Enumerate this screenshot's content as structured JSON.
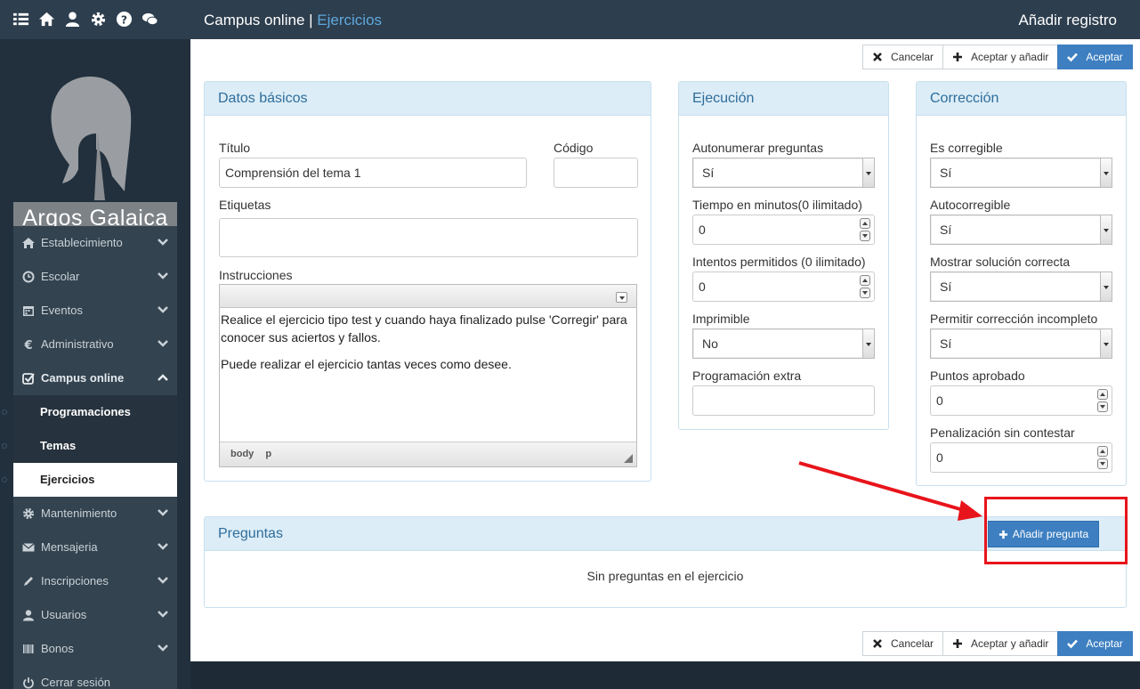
{
  "topbar": {
    "app": "Campus online",
    "separator": "|",
    "section": "Ejercicios",
    "action": "Añadir registro",
    "icons": [
      "list-icon",
      "home-icon",
      "user-icon",
      "gear-icon",
      "help-icon",
      "chat-icon"
    ]
  },
  "brand": {
    "name": "Argos Galaica"
  },
  "sidebar": {
    "items": [
      {
        "label": "Establecimiento",
        "icon": "home-icon"
      },
      {
        "label": "Escolar",
        "icon": "clock-icon"
      },
      {
        "label": "Eventos",
        "icon": "calendar-icon"
      },
      {
        "label": "Administrativo",
        "icon": "euro-icon"
      },
      {
        "label": "Campus online",
        "icon": "checkbox-icon"
      },
      {
        "label": "Mantenimiento",
        "icon": "gear-icon"
      },
      {
        "label": "Mensajeria",
        "icon": "envelope-icon"
      },
      {
        "label": "Inscripciones",
        "icon": "pencil-icon"
      },
      {
        "label": "Usuarios",
        "icon": "user-icon"
      },
      {
        "label": "Bonos",
        "icon": "barcode-icon"
      },
      {
        "label": "Cerrar sesión",
        "icon": "power-icon"
      }
    ],
    "subitems": [
      {
        "label": "Programaciones"
      },
      {
        "label": "Temas"
      },
      {
        "label": "Ejercicios"
      }
    ]
  },
  "actions": {
    "cancel": "Cancelar",
    "accept_add": "Aceptar y añadir",
    "accept": "Aceptar"
  },
  "basic": {
    "title": "Datos básicos",
    "title_label": "Título",
    "title_value": "Comprensión del tema 1",
    "code_label": "Código",
    "code_value": "",
    "tags_label": "Etiquetas",
    "tags_value": "",
    "instructions_label": "Instrucciones",
    "instructions_p1": "Realice el ejercicio tipo test y cuando haya finalizado pulse 'Corregir' para conocer sus aciertos y fallos.",
    "instructions_p2": "Puede realizar el ejercicio tantas veces como desee.",
    "status_body": "body",
    "status_p": "p"
  },
  "execution": {
    "title": "Ejecución",
    "autonumber_label": "Autonumerar preguntas",
    "autonumber_value": "Sí",
    "time_label": "Tiempo en minutos(0 ilimitado)",
    "time_value": "0",
    "attempts_label": "Intentos permitidos (0 ilimitado)",
    "attempts_value": "0",
    "printable_label": "Imprimible",
    "printable_value": "No",
    "extra_label": "Programación extra",
    "extra_value": ""
  },
  "correction": {
    "title": "Corrección",
    "correctable_label": "Es corregible",
    "correctable_value": "Sí",
    "autocorrect_label": "Autocorregible",
    "autocorrect_value": "Sí",
    "show_solution_label": "Mostrar solución correcta",
    "show_solution_value": "Sí",
    "allow_incomplete_label": "Permitir corrección incompleto",
    "allow_incomplete_value": "Sí",
    "pass_points_label": "Puntos aprobado",
    "pass_points_value": "0",
    "penalty_label": "Penalización sin contestar",
    "penalty_value": "0"
  },
  "questions": {
    "title": "Preguntas",
    "add_button": "Añadir pregunta",
    "empty": "Sin preguntas en el ejercicio"
  },
  "colors": {
    "accent": "#3d7fc1",
    "annotation": "#e8141b",
    "panel_header": "#dcedf7"
  }
}
